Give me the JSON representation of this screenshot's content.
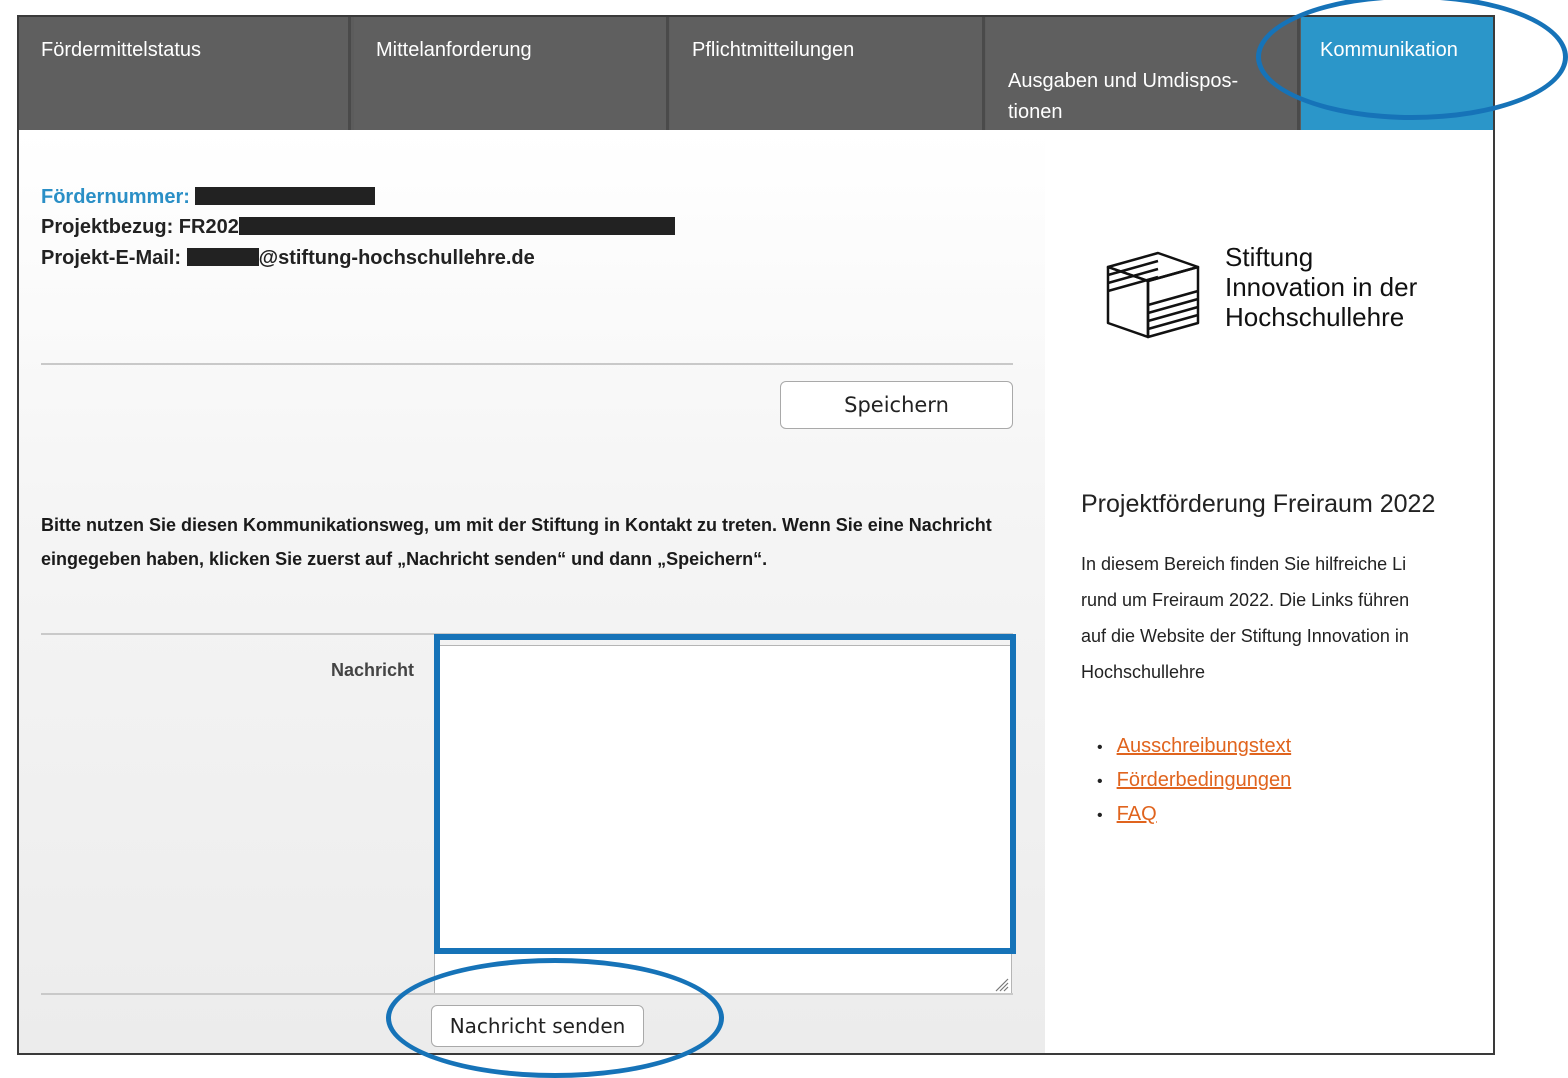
{
  "nav": {
    "tabs": [
      {
        "label": "Fördermittelstatus"
      },
      {
        "label": "Mittelanforderung"
      },
      {
        "label": "Pflichtmitteilungen"
      },
      {
        "label": "Ausgaben und Umdispos-\ntionen"
      },
      {
        "label": "Kommunikation",
        "active": true
      }
    ]
  },
  "project": {
    "foerdernummer_label": "Fördernummer:",
    "projektbezug_label": "Projektbezug: FR202",
    "email_label": "Projekt-E-Mail:",
    "email_domain": "@stiftung-hochschullehre.de"
  },
  "buttons": {
    "save": "Speichern",
    "send": "Nachricht senden"
  },
  "instructions": "Bitte nutzen Sie diesen Kommunikationsweg, um mit der Stiftung in Kontakt zu treten. Wenn Sie eine Nachricht eingegeben haben, klicken Sie zuerst auf „Nachricht senden“ und dann „Speichern“.",
  "message": {
    "label": "Nachricht",
    "value": ""
  },
  "sidebar": {
    "logo_lines": [
      "Stiftung",
      "Innovation in der",
      "Hochschullehre"
    ],
    "title": "Projektförderung Freiraum 2022",
    "description": "In diesem Bereich finden Sie hilfreiche Li\nrund um Freiraum 2022. Die Links führen\nauf die Website der Stiftung Innovation in\nHochschullehre",
    "links": [
      {
        "label": "Ausschreibungstext"
      },
      {
        "label": "Förderbedingungen"
      },
      {
        "label": "FAQ"
      }
    ]
  },
  "colors": {
    "nav_bg": "#5f5f5f",
    "active_tab": "#2b96c9",
    "label_blue": "#2a8fc6",
    "link_orange": "#e0641e",
    "annotation": "#1673b8"
  }
}
